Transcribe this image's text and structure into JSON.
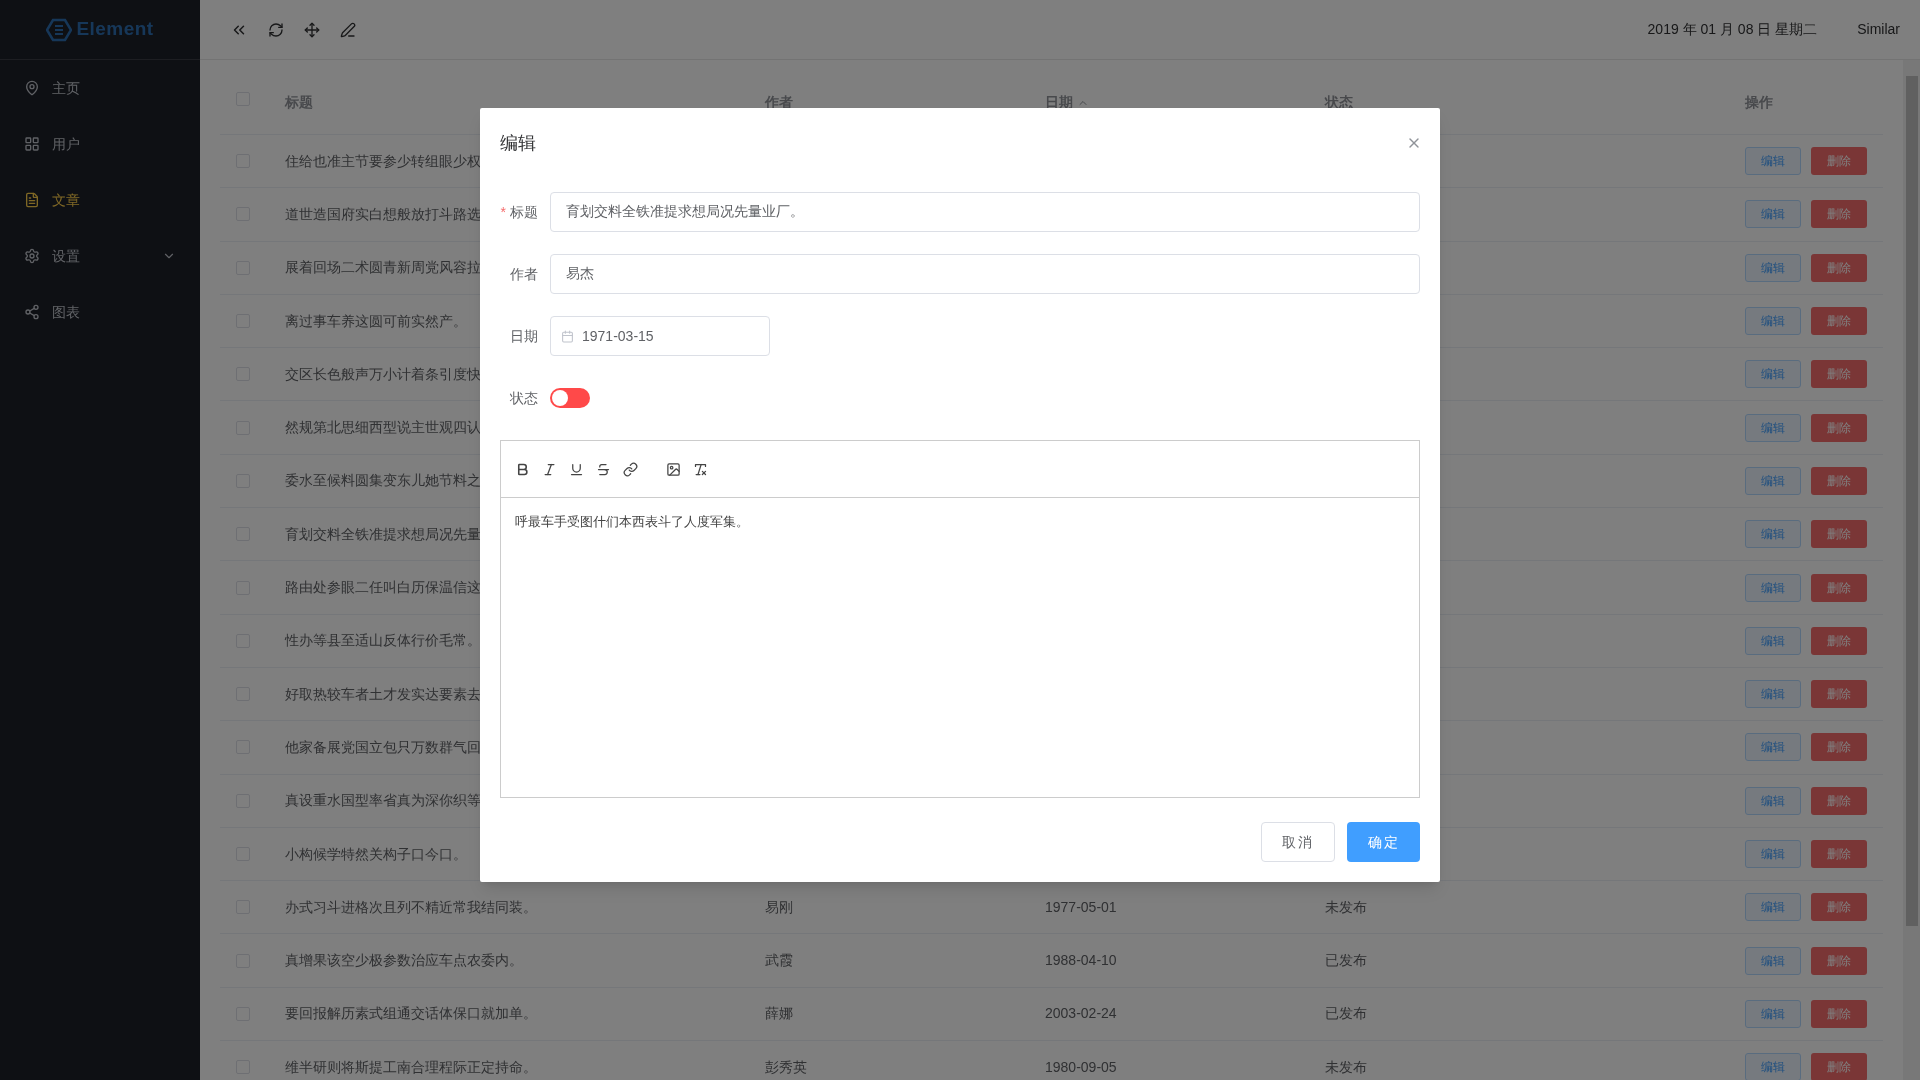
{
  "sidebar": {
    "logo": "Element",
    "items": [
      {
        "label": "主页",
        "selected": false
      },
      {
        "label": "用户",
        "selected": false
      },
      {
        "label": "文章",
        "selected": true
      },
      {
        "label": "设置",
        "selected": false,
        "expandable": true
      },
      {
        "label": "图表",
        "selected": false
      }
    ]
  },
  "topbar": {
    "date": "2019 年 01 月 08 日 星期二",
    "user": "Similar"
  },
  "table": {
    "header_checked": false,
    "columns": [
      {
        "label": "标题",
        "sorted": false
      },
      {
        "label": "作者",
        "sorted": false
      },
      {
        "label": "日期",
        "sorted": true
      },
      {
        "label": "状态",
        "sorted": false
      },
      {
        "label": "操作",
        "sorted": false
      }
    ],
    "rows": [
      {
        "title": "住给也准主节要参少转组眼少权",
        "checked": false,
        "actions": [
          "编辑",
          "删除"
        ]
      },
      {
        "title": "道世造国府实白想般放打斗路选",
        "checked": false,
        "actions": [
          "编辑",
          "删除"
        ]
      },
      {
        "title": "展着回场二术圆青新周党风容拉",
        "checked": false,
        "actions": [
          "编辑",
          "删除"
        ]
      },
      {
        "title": "离过事车养这圆可前实然产。",
        "checked": false,
        "actions": [
          "编辑",
          "删除"
        ]
      },
      {
        "title": "交区长色般声万小计着条引度快",
        "checked": false,
        "actions": [
          "编辑",
          "删除"
        ]
      },
      {
        "title": "然规第北思细西型说主世观四认",
        "checked": false,
        "actions": [
          "编辑",
          "删除"
        ]
      },
      {
        "title": "委水至候料圆集变东儿她节料之",
        "checked": false,
        "actions": [
          "编辑",
          "删除"
        ]
      },
      {
        "title": "育划交料全铁准提求想局况先量",
        "checked": false,
        "actions": [
          "编辑",
          "删除"
        ]
      },
      {
        "title": "路由处参眼二任叫白历保温信这",
        "checked": false,
        "actions": [
          "编辑",
          "删除"
        ]
      },
      {
        "title": "性办等县至适山反体行价毛常。",
        "checked": false,
        "actions": [
          "编辑",
          "删除"
        ]
      },
      {
        "title": "好取热较车者土才发实达要素去",
        "checked": false,
        "actions": [
          "编辑",
          "删除"
        ]
      },
      {
        "title": "他家备展党国立包只万数群气回",
        "checked": false,
        "actions": [
          "编辑",
          "删除"
        ]
      },
      {
        "title": "真设重水国型率省真为深你织等",
        "checked": false,
        "actions": [
          "编辑",
          "删除"
        ]
      },
      {
        "title": "小构候学特然关构子口今口。",
        "checked": false,
        "actions": [
          "编辑",
          "删除"
        ]
      },
      {
        "title": "办式习斗进格次且列不精近常我结同装。",
        "author": "易刚",
        "date": "1977-05-01",
        "status": "未发布",
        "checked": false,
        "actions": [
          "编辑",
          "删除"
        ]
      },
      {
        "title": "真增果该空少极参数治应车点农委内。",
        "author": "武霞",
        "date": "1988-04-10",
        "status": "已发布",
        "checked": false,
        "actions": [
          "编辑",
          "删除"
        ]
      },
      {
        "title": "要回报解历素式组通交话体保口就加单。",
        "author": "薛娜",
        "date": "2003-02-24",
        "status": "已发布",
        "checked": false,
        "actions": [
          "编辑",
          "删除"
        ]
      },
      {
        "title": "维半研则将斯提工南合理程际正定持命。",
        "author": "彭秀英",
        "date": "1980-09-05",
        "status": "未发布",
        "checked": false,
        "actions": [
          "编辑",
          "删除"
        ]
      }
    ]
  },
  "dialog": {
    "title": "编辑",
    "fields": [
      {
        "kind": "text",
        "label": "标题",
        "required_mark": "*",
        "value": "育划交料全铁准提求想局况先量业厂。"
      },
      {
        "kind": "text",
        "label": "作者",
        "value": "易杰"
      },
      {
        "kind": "date",
        "label": "日期",
        "value": "1971-03-15"
      },
      {
        "kind": "switch",
        "label": "状态",
        "on": false
      }
    ],
    "editor": {
      "content": "呼最车手受图什们本西表斗了人度军集。"
    },
    "buttons": [
      {
        "label": "取消",
        "kind": "default"
      },
      {
        "label": "确定",
        "kind": "primary"
      }
    ]
  }
}
